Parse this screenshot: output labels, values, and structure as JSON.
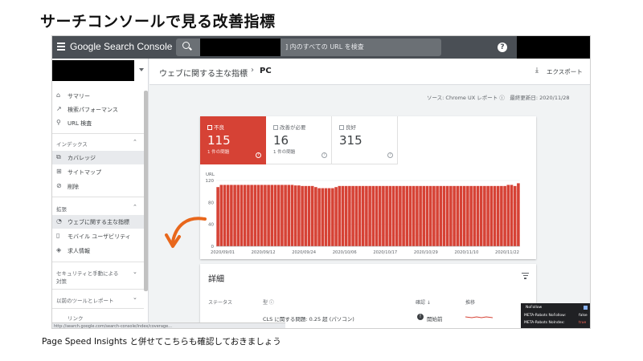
{
  "slide": {
    "title": "サーチコンソールで見る改善指標",
    "caption": "Page Speed Insights と併せてこちらも確認しておきましょう"
  },
  "topbar": {
    "menu_icon": "menu-icon",
    "logo": "Google Search Console",
    "search_placeholder": "] 内のすべての URL を検査",
    "help": "?"
  },
  "sidebar": {
    "items": [
      {
        "icon": "⌂",
        "label": "サマリー"
      },
      {
        "icon": "↗",
        "label": "検索パフォーマンス"
      },
      {
        "icon": "⚲",
        "label": "URL 検査"
      }
    ],
    "index_section": "インデックス",
    "index_items": [
      {
        "icon": "⧉",
        "label": "カバレッジ"
      },
      {
        "icon": "⊞",
        "label": "サイトマップ"
      },
      {
        "icon": "⊘",
        "label": "削除"
      }
    ],
    "enh_section": "拡張",
    "enh_items": [
      {
        "icon": "◔",
        "label": "ウェブに関する主な指標"
      },
      {
        "icon": "▯",
        "label": "モバイル ユーザビリティ"
      },
      {
        "icon": "◈",
        "label": "求人情報"
      }
    ],
    "security_section_line1": "セキュリティと手動による",
    "security_section_line2": "対策",
    "legacy_section": "以前のツールとレポート",
    "links_label": "リンク"
  },
  "header": {
    "breadcrumb": "ウェブに関する主な指標",
    "separator": "›",
    "current": "PC",
    "export_label": "エクスポート"
  },
  "source_line": "ソース: Chrome UX レポート ⓘ　最終更新日: 2020/11/28",
  "tiles": [
    {
      "label": "不良",
      "value": "115",
      "sub": "1 件の問題",
      "help": "?"
    },
    {
      "label": "改善が必要",
      "value": "16",
      "sub": "1 件の問題",
      "help": "?"
    },
    {
      "label": "良好",
      "value": "315",
      "sub": "",
      "help": "?"
    }
  ],
  "chart_data": {
    "type": "bar",
    "ylabel": "URL",
    "ylim": [
      0,
      120
    ],
    "yticks": [
      0,
      40,
      80,
      120
    ],
    "y_gridlines_intermediate": [
      20,
      60,
      100
    ],
    "color": "#d64235",
    "xtick_labels": [
      "2020/09/01",
      "2020/09/12",
      "2020/09/24",
      "2020/10/06",
      "2020/10/17",
      "2020/10/29",
      "2020/11/10",
      "2020/11/22"
    ],
    "values": [
      108,
      112,
      112,
      112,
      112,
      112,
      112,
      112,
      112,
      112,
      112,
      112,
      112,
      112,
      112,
      112,
      112,
      112,
      112,
      112,
      112,
      112,
      112,
      111,
      111,
      110,
      110,
      110,
      110,
      108,
      106,
      106,
      106,
      106,
      106,
      108,
      110,
      110,
      110,
      110,
      110,
      110,
      110,
      110,
      110,
      110,
      110,
      110,
      110,
      110,
      110,
      110,
      110,
      110,
      110,
      110,
      110,
      110,
      110,
      110,
      110,
      110,
      110,
      110,
      110,
      110,
      110,
      110,
      110,
      110,
      110,
      110,
      110,
      110,
      110,
      110,
      110,
      110,
      110,
      110,
      110,
      110,
      110,
      110,
      110,
      110,
      112,
      112,
      110,
      115
    ]
  },
  "details": {
    "title": "詳細",
    "columns": {
      "status": "ステータス",
      "type": "型 ⓘ",
      "validation": "確認 ↓",
      "trend": "推移"
    },
    "row": {
      "type_text": "CLS に関する問題: 0.25 超 (パソコン)",
      "validation": "開始前",
      "status_icon": "!"
    }
  },
  "url_status": "http://search.google.com/search-console/index/coverage...",
  "nofollow": {
    "title": "NoFollow",
    "row1_label": "META-Robots NoFollow:",
    "row1_value": "false",
    "row2_label": "META-Robots NoIndex:",
    "row2_value": "true"
  },
  "accent_colors": {
    "poor": "#d64235",
    "topbar": "#4a4f55",
    "arrow": "#e8671c"
  }
}
